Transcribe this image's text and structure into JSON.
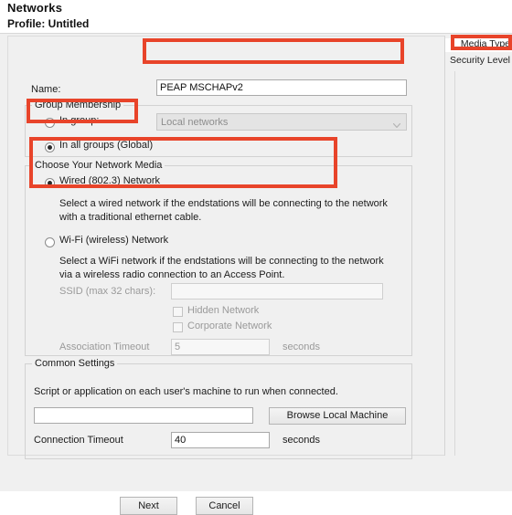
{
  "header": {
    "title": "Networks",
    "profile_line": "Profile:  Untitled"
  },
  "sidebar": {
    "items": [
      {
        "label": "Media Type",
        "selected": true
      },
      {
        "label": "Security Level",
        "selected": false
      }
    ]
  },
  "form": {
    "name_label": "Name:",
    "name_value": "PEAP MSCHAPv2",
    "name_placeholder": ""
  },
  "group_membership": {
    "title": "Group Membership",
    "in_group_label": "In group:",
    "in_group_selected": false,
    "group_select_value": "Local networks",
    "group_select_disabled": true,
    "in_all_groups_label": "In all groups (Global)",
    "in_all_groups_selected": true
  },
  "network_media": {
    "title": "Choose Your Network Media",
    "wired": {
      "label": "Wired (802.3) Network",
      "selected": true,
      "desc_line1": "Select a wired network if the endstations will be connecting to the network",
      "desc_line2": "with a traditional ethernet cable."
    },
    "wifi": {
      "label": "Wi-Fi (wireless) Network",
      "selected": false,
      "desc_line1": "Select a WiFi network if the endstations will be connecting to the network",
      "desc_line2": "via a wireless radio connection to an Access Point.",
      "ssid_label": "SSID (max 32 chars):",
      "ssid_value": "",
      "hidden_network_label": "Hidden Network",
      "hidden_network_checked": false,
      "corporate_network_label": "Corporate Network",
      "corporate_network_checked": false,
      "assoc_timeout_label": "Association Timeout",
      "assoc_timeout_value": "5",
      "assoc_timeout_units": "seconds"
    }
  },
  "common_settings": {
    "title": "Common Settings",
    "script_desc": "Script or application on each user's machine to run when connected.",
    "script_value": "",
    "browse_label": "Browse Local Machine",
    "connection_timeout_label": "Connection Timeout",
    "connection_timeout_value": "40",
    "connection_timeout_units": "seconds"
  },
  "footer": {
    "next_label": "Next",
    "cancel_label": "Cancel"
  },
  "annotations": {
    "highlight_color": "#e8442a"
  }
}
